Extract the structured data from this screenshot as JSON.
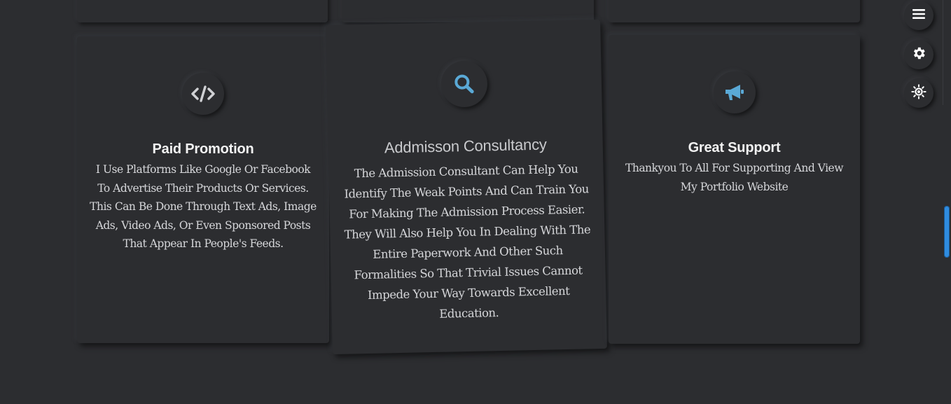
{
  "colors": {
    "background": "#2c2d30",
    "accent": "#5aa9d6",
    "scrollbar": "#2f8ce0"
  },
  "cards": [
    {
      "icon": "code-icon",
      "title": "Paid Promotion",
      "text": "I Use Platforms Like Google Or Facebook To Advertise Their Products Or Services. This Can Be Done Through Text Ads, Image Ads, Video Ads, Or Even Sponsored Posts That Appear In People's Feeds."
    },
    {
      "icon": "search-icon",
      "title": "Addmisson Consultancy",
      "text": "The Admission Consultant Can Help You Identify The Weak Points And Can Train You For Making The Admission Process Easier. They Will Also Help You In Dealing With The Entire Paperwork And Other Such Formalities So That Trivial Issues Cannot Impede Your Way Towards Excellent Education."
    },
    {
      "icon": "megaphone-icon",
      "title": "Great Support",
      "text": "Thankyou To All For Supporting And View My Portfolio Website"
    }
  ],
  "side_controls": [
    {
      "icon": "menu-icon"
    },
    {
      "icon": "gear-icon"
    },
    {
      "icon": "theme-toggle-icon"
    }
  ]
}
